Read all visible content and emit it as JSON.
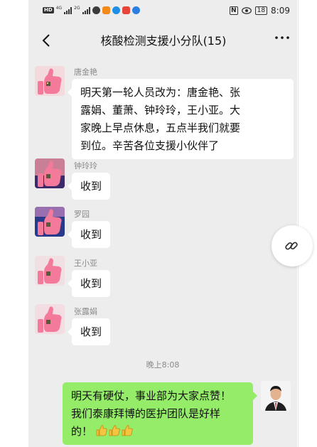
{
  "status_bar": {
    "left_chip": "HD",
    "signal_1": "4G",
    "signal_2": "2G",
    "time": "8:09",
    "battery": "18",
    "nfc": "N"
  },
  "chat": {
    "title": "核酸检测支援小分队(15)"
  },
  "messages": [
    {
      "sender": "唐金艳",
      "lines": [
        "明天第一轮人员改为：唐金艳、张",
        "露娟、董萧、钟玲玲，王小亚。大",
        "家晚上早点休息，五点半我们就要",
        "到位。辛苦各位支援小伙伴了"
      ]
    },
    {
      "sender": "钟玲玲",
      "text": "收到"
    },
    {
      "sender": "罗园",
      "text": "收到"
    },
    {
      "sender": "王小亚",
      "text": "收到"
    },
    {
      "sender": "张露娟",
      "text": "收到"
    }
  ],
  "timestamp": "晚上8:08",
  "my_message": {
    "lines": [
      "明天有硬仗，事业部为大家点赞！",
      "我们泰康拜博的医护团队是好样",
      "的！"
    ],
    "emoji": "thumbs-up-emoji"
  },
  "icons": {
    "back": "chevron-left-icon",
    "more": "more-dots-icon",
    "link": "link-icon",
    "eye": "eye-icon"
  },
  "colors": {
    "chat_bg": "#ededed",
    "my_bubble": "#95ec69",
    "other_bubble": "#ffffff"
  }
}
